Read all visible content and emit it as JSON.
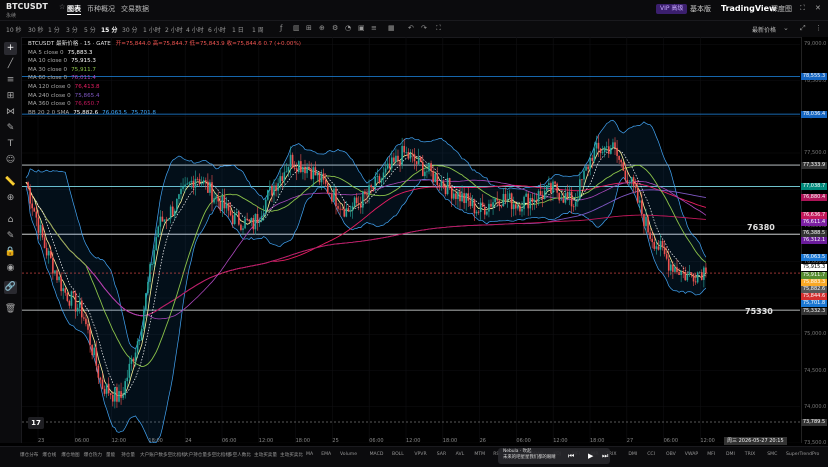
{
  "header": {
    "symbol": "BTCUSDT",
    "subtitle": "永续",
    "tabs": [
      {
        "label": "图表",
        "active": true
      },
      {
        "label": "币种概况",
        "active": false
      },
      {
        "label": "交易数据",
        "active": false
      }
    ],
    "premium_label": "VIP 高级",
    "fundamentals_label": "基本版",
    "tradingview_label": "TradingView",
    "depth_label": "深度图"
  },
  "timeframes": [
    {
      "label": "10 秒",
      "active": false
    },
    {
      "label": "30 秒",
      "active": false
    },
    {
      "label": "1 分",
      "active": false
    },
    {
      "label": "3 分",
      "active": false
    },
    {
      "label": "5 分",
      "active": false
    },
    {
      "label": "15 分",
      "active": true
    },
    {
      "label": "30 分",
      "active": false
    },
    {
      "label": "1 小时",
      "active": false
    },
    {
      "label": "2 小时",
      "active": false
    },
    {
      "label": "4 小时",
      "active": false
    },
    {
      "label": "6 小时",
      "active": false
    },
    {
      "label": "1 日",
      "active": false
    },
    {
      "label": "1 周",
      "active": false
    }
  ],
  "latest_price_label": "最新价格",
  "legend": {
    "header": "BTCUSDT 最新价格 · 15 · GATE",
    "ohlc": "开=75,844.0  高=75,844.7  低=75,843.9  收=75,844.6  0.7 (+0.00%)",
    "ma": [
      {
        "label": "MA 5 close 0",
        "value": "75,883.3",
        "color": "#ffffff"
      },
      {
        "label": "MA 10 close 0",
        "value": "75,915.3",
        "color": "#ffffff"
      },
      {
        "label": "MA 30 close 0",
        "value": "75,911.7",
        "color": "#8bc34a"
      },
      {
        "label": "MA 60 close 0",
        "value": "76,011.4",
        "color": "#ab47bc"
      },
      {
        "label": "MA 120 close 0",
        "value": "76,413.8",
        "color": "#e91e63"
      },
      {
        "label": "MA 240 close 0",
        "value": "75,865.4",
        "color": "#7e57c2"
      },
      {
        "label": "MA 360 close 0",
        "value": "76,650.7",
        "color": "#c2185b"
      }
    ],
    "bb": {
      "label": "BB 20 2 0 SMA",
      "values": [
        "75,882.6",
        "76,063.5",
        "75,701.8"
      ],
      "colors": [
        "#ffffff",
        "#42a5f5",
        "#42a5f5"
      ]
    }
  },
  "price_axis": {
    "ticks": [
      "79,000.0",
      "78,500.0",
      "78,000.0",
      "77,500.0",
      "77,000.0",
      "76,500.0",
      "76,000.0",
      "75,500.0",
      "75,000.0",
      "74,500.0",
      "74,000.0",
      "73,500.0"
    ],
    "badges": [
      {
        "text": "78,555.3",
        "color": "#1565c0"
      },
      {
        "text": "78,036.4",
        "color": "#1565c0"
      },
      {
        "text": "77,333.9",
        "color": "#333"
      },
      {
        "text": "77,038.7",
        "color": "#00897b"
      },
      {
        "text": "76,880.4",
        "color": "#ad1457"
      },
      {
        "text": "76,636.7",
        "color": "#c2185b"
      },
      {
        "text": "76,611.4",
        "color": "#7b1fa2"
      },
      {
        "text": "76,388.5",
        "color": "#333"
      },
      {
        "text": "76,312.1",
        "color": "#6a1b9a"
      },
      {
        "text": "76,063.5",
        "color": "#1976d2"
      },
      {
        "text": "75,915.3",
        "color": "#fff"
      },
      {
        "text": "75,911.7",
        "color": "#558b2f"
      },
      {
        "text": "75,883.3",
        "color": "#f9a825"
      },
      {
        "text": "75,882.6",
        "color": "#555"
      },
      {
        "text": "75,844.6",
        "color": "#d32f2f"
      },
      {
        "text": "75,701.8",
        "color": "#1976d2"
      },
      {
        "text": "75,332.3",
        "color": "#333"
      },
      {
        "text": "73,789.5",
        "color": "#333"
      }
    ]
  },
  "horizontal_levels": [
    {
      "price": 78555.3,
      "color": "#1e88e5",
      "label": ""
    },
    {
      "price": 78036.4,
      "color": "#1e88e5",
      "label": ""
    },
    {
      "price": 77333.9,
      "color": "#cfd8dc",
      "label": ""
    },
    {
      "price": 77038.7,
      "color": "#80deea",
      "label": ""
    },
    {
      "price": 76380,
      "color": "#eceff1",
      "label": "76380"
    },
    {
      "price": 75332.3,
      "color": "#eceff1",
      "label": "75330"
    },
    {
      "price": 73789.5,
      "color": "#777777",
      "label": ""
    }
  ],
  "time_axis": {
    "ticks": [
      "23",
      "06:00",
      "12:00",
      "18:00",
      "24",
      "06:00",
      "12:00",
      "18:00",
      "25",
      "06:00",
      "12:00",
      "18:00",
      "26",
      "06:00",
      "12:00",
      "18:00",
      "27",
      "06:00",
      "12:00"
    ],
    "cursor_label": "周三 2026-05-27  20:15"
  },
  "bottom_indicators": [
    "爆仓分布",
    "爆仓线",
    "爆仓地图",
    "爆仓热力",
    "量能",
    "持仓量",
    "大户账户数多空比指标",
    "大户持仓量多空比指标",
    "多空人数比",
    "主动买卖量",
    "主动买卖比",
    "MA",
    "EMA",
    "Volume",
    "MACD",
    "BOLL",
    "VPVR",
    "SAR",
    "AVL",
    "MTM",
    "RSI",
    "BBI",
    "BRAR",
    "KDJ",
    "MFI",
    "WR",
    "TRIX",
    "DMI",
    "CCI",
    "OBV",
    "VWAP",
    "MFI",
    "DMI",
    "TRIX",
    "SMC",
    "SuperTrendPro"
  ],
  "media": {
    "line1": "Nebula · 吹起",
    "line2": "未来的吧星星我们都的眼睛"
  },
  "chart_data": {
    "type": "candlestick",
    "symbol": "BTCUSDT",
    "interval": "15 分",
    "ylim": [
      73500,
      79100
    ],
    "last_price": 75844.6,
    "close_trajectory": [
      77100,
      76200,
      75600,
      75300,
      74300,
      74100,
      75000,
      76500,
      76800,
      77200,
      76900,
      76600,
      76500,
      77000,
      77400,
      77300,
      77000,
      76700,
      76900,
      77200,
      77500,
      77300,
      77100,
      76900,
      76700,
      76900,
      76800,
      76900,
      77000,
      76800,
      77500,
      77600,
      77100,
      76400,
      76000,
      75800,
      75900
    ]
  }
}
